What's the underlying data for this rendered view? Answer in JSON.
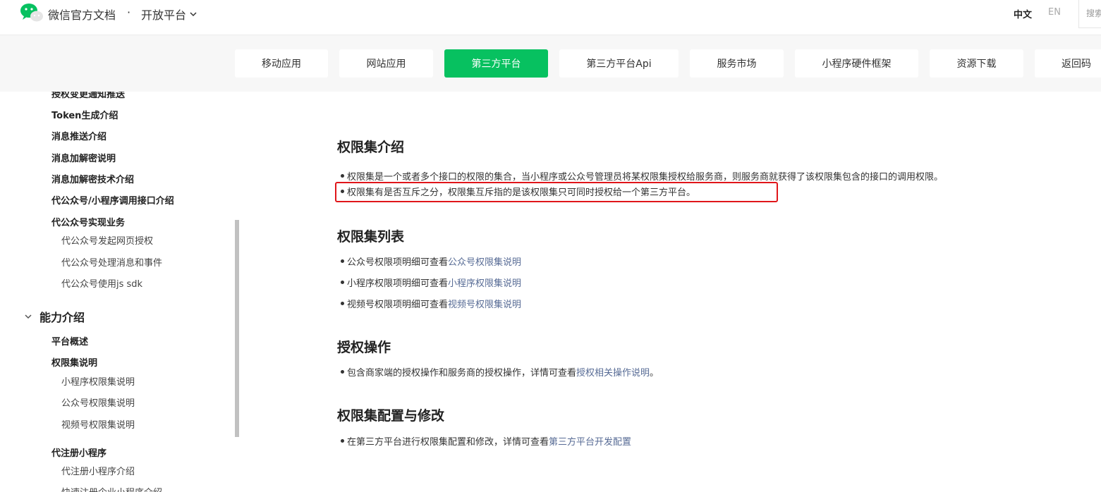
{
  "header": {
    "brand": "微信官方文档",
    "separator": "·",
    "platform": "开放平台",
    "lang_zh": "中文",
    "lang_en": "EN",
    "search_label": "搜索"
  },
  "nav": {
    "tabs": [
      {
        "label": "移动应用"
      },
      {
        "label": "网站应用"
      },
      {
        "label": "第三方平台",
        "active": true
      },
      {
        "label": "第三方平台Api"
      },
      {
        "label": "服务市场"
      },
      {
        "label": "小程序硬件框架"
      },
      {
        "label": "资源下载"
      },
      {
        "label": "返回码"
      }
    ]
  },
  "sidebar": {
    "items": [
      {
        "label": "授权变更通知推送"
      },
      {
        "label": "Token生成介绍"
      },
      {
        "label": "消息推送介绍"
      },
      {
        "label": "消息加解密说明"
      },
      {
        "label": "消息加解密技术介绍"
      },
      {
        "label": "代公众号/小程序调用接口介绍"
      },
      {
        "label": "代公众号实现业务"
      },
      {
        "label": "代公众号发起网页授权"
      },
      {
        "label": "代公众号处理消息和事件"
      },
      {
        "label": "代公众号使用js sdk"
      },
      {
        "label": "能力介绍"
      },
      {
        "label": "平台概述"
      },
      {
        "label": "权限集说明"
      },
      {
        "label": "小程序权限集说明"
      },
      {
        "label": "公众号权限集说明"
      },
      {
        "label": "视频号权限集说明"
      },
      {
        "label": "代注册小程序"
      },
      {
        "label": "代注册小程序介绍"
      },
      {
        "label": "快速注册企业小程序介绍"
      }
    ]
  },
  "content": {
    "sections": [
      {
        "title": "权限集介绍",
        "items": [
          {
            "text": "权限集是一个或者多个接口的权限的集合，当小程序或公众号管理员将某权限集授权给服务商，则服务商就获得了该权限集包含的接口的调用权限。"
          },
          {
            "text": "权限集有是否互斥之分，权限集互斥指的是该权限集只可同时授权给一个第三方平台。"
          }
        ]
      },
      {
        "title": "权限集列表",
        "items": [
          {
            "text": "公众号权限项明细可查看",
            "link": "公众号权限集说明"
          },
          {
            "text": "小程序权限项明细可查看",
            "link": "小程序权限集说明"
          },
          {
            "text": "视频号权限项明细可查看",
            "link": "视频号权限集说明"
          }
        ]
      },
      {
        "title": "授权操作",
        "items": [
          {
            "text": "包含商家端的授权操作和服务商的授权操作，详情可查看",
            "link": "授权相关操作说明",
            "suffix": "。"
          }
        ]
      },
      {
        "title": "权限集配置与修改",
        "items": [
          {
            "text": "在第三方平台进行权限集配置和修改，详情可查看",
            "link": "第三方平台开发配置"
          }
        ]
      }
    ]
  },
  "colors": {
    "accent": "#07c160",
    "link": "#576b95",
    "highlight": "#e0161a"
  }
}
